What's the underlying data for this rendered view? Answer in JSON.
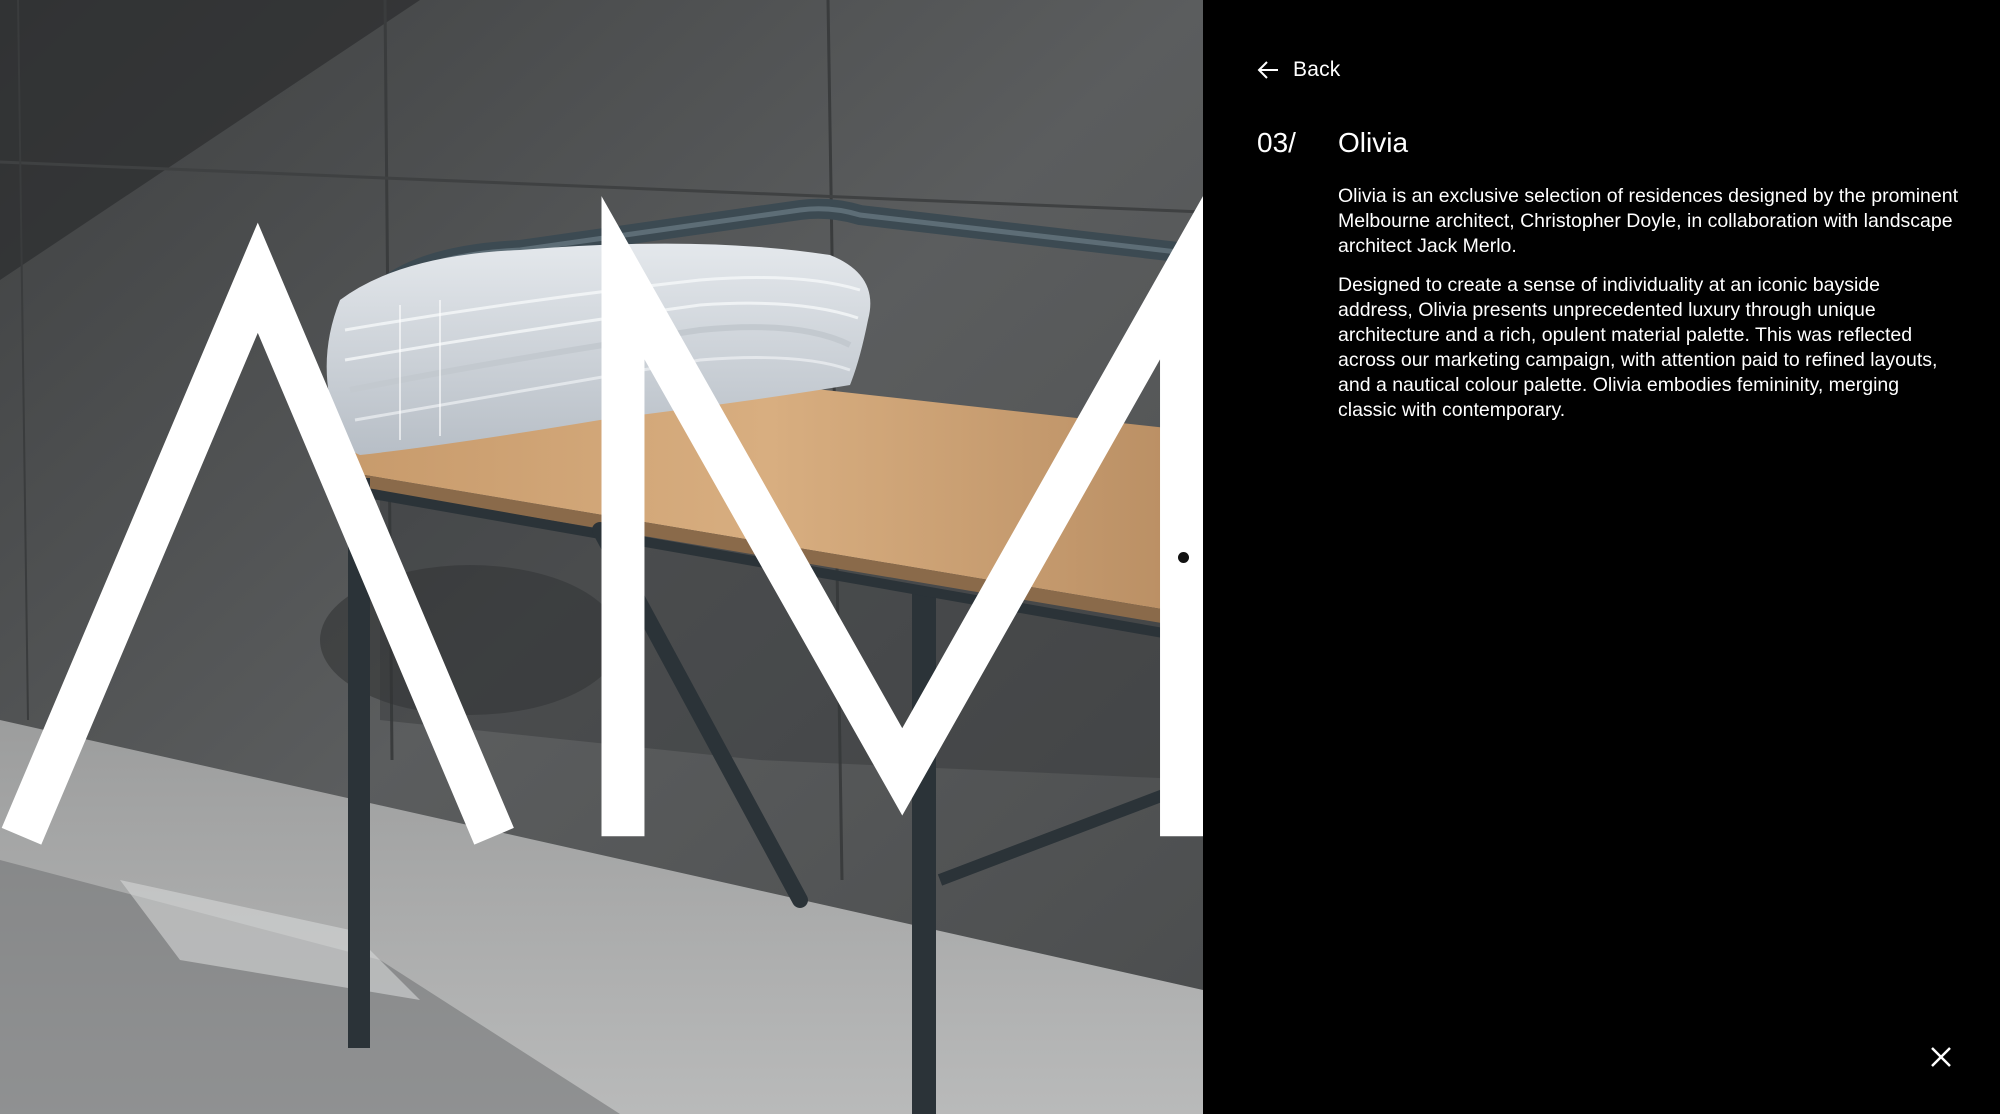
{
  "brand": {
    "logo_text": "AM"
  },
  "navigation": {
    "back_label": "Back",
    "back_icon": "arrow-left-icon",
    "close_icon": "close-icon"
  },
  "project": {
    "number": "03/",
    "name": "Olivia",
    "description": [
      "Olivia is an exclusive selection of residences designed by the prominent Melbourne architect, Christopher Doyle, in collaboration with landscape architect Jack Merlo.",
      "Designed to create a sense of individuality at an iconic bayside address, Olivia presents unprecedented luxury through unique architecture and a rich, opulent material palette. This was reflected across our marketing campaign, with attention paid to refined layouts, and a nautical colour palette. Olivia embodies femininity, merging classic with contemporary."
    ]
  },
  "image": {
    "subject": "folded-towel-on-wooden-bench"
  },
  "colors": {
    "panel_background": "#000000",
    "text": "#ffffff"
  }
}
